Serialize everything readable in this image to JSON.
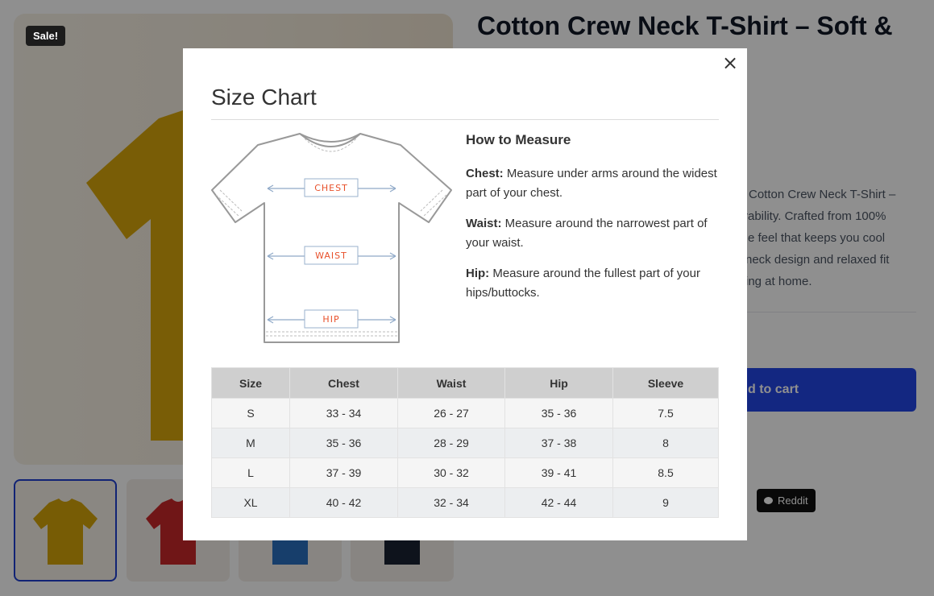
{
  "product": {
    "sale_badge": "Sale!",
    "title": "Cotton Crew Neck T-Shirt – Soft &",
    "description_lines": [
      "Cotton Crew Neck T-Shirt –",
      "rability. Crafted from 100%",
      "e feel that keeps you cool",
      "neck design and relaxed fit",
      "ing at home."
    ],
    "add_to_cart_label": "d to cart",
    "share_reddit_label": "Reddit",
    "thumbnail_colors": [
      "#d4a40a",
      "#c8282a",
      "#2a6fbf",
      "#1a2233"
    ]
  },
  "modal": {
    "title": "Size Chart",
    "close_icon": "×",
    "diagram_labels": {
      "chest": "CHEST",
      "waist": "WAIST",
      "hip": "HIP"
    },
    "how_to_measure": {
      "heading": "How to Measure",
      "items": [
        {
          "term": "Chest:",
          "text": " Measure under arms around the widest part of your chest."
        },
        {
          "term": "Waist:",
          "text": " Measure around the narrowest part of your waist."
        },
        {
          "term": "Hip:",
          "text": " Measure around the fullest part of your hips/buttocks."
        }
      ]
    },
    "table": {
      "headers": [
        "Size",
        "Chest",
        "Waist",
        "Hip",
        "Sleeve"
      ],
      "rows": [
        [
          "S",
          "33 - 34",
          "26 - 27",
          "35 - 36",
          "7.5"
        ],
        [
          "M",
          "35 - 36",
          "28 - 29",
          "37 - 38",
          "8"
        ],
        [
          "L",
          "37 - 39",
          "30 - 32",
          "39 - 41",
          "8.5"
        ],
        [
          "XL",
          "40 - 42",
          "32 - 34",
          "42 - 44",
          "9"
        ]
      ]
    }
  }
}
